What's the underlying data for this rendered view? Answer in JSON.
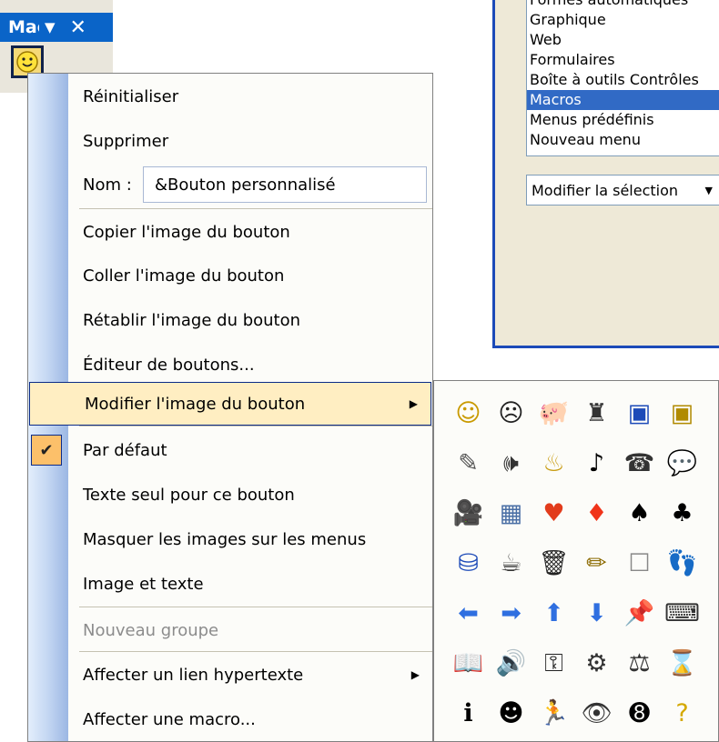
{
  "minibar": {
    "title": "Macros",
    "dropdown_glyph": "▼",
    "close_glyph": "✕",
    "button_icon": "smiley-icon"
  },
  "dialog": {
    "list_items": [
      "Formes automatiques",
      "Graphique",
      "Web",
      "Formulaires",
      "Boîte à outils Contrôles",
      "Macros",
      "Menus prédéfinis",
      "Nouveau menu"
    ],
    "selected_item": "Macros",
    "modify_selection_label": "Modifier la sélection"
  },
  "menu": {
    "reset": "Réinitialiser",
    "delete": "Supprimer",
    "name_label": "Nom :",
    "name_value": "&Bouton personnalisé",
    "copy_image": "Copier l'image du bouton",
    "paste_image": "Coller l'image du bouton",
    "restore_image": "Rétablir l'image du bouton",
    "button_editor": "Éditeur de boutons...",
    "change_image": "Modifier l'image du bouton",
    "default_style": "Par défaut",
    "text_only": "Texte seul pour ce bouton",
    "hide_images": "Masquer les images sur les menus",
    "image_and_text": "Image et texte",
    "new_group": "Nouveau groupe",
    "assign_hyperlink": "Affecter un lien hypertexte",
    "assign_macro": "Affecter une macro..."
  },
  "colors": {
    "title_bar": "#0a64c8",
    "highlight": "#ffeec2",
    "highlight_border": "#0b2b88",
    "selection": "#316ac5",
    "checked": "#fcc06a"
  },
  "picker": {
    "icons": [
      {
        "name": "smiley-icon",
        "glyph": "☺",
        "color": "#c99a00"
      },
      {
        "name": "frown-icon",
        "glyph": "☹",
        "color": "#222"
      },
      {
        "name": "piggy-bank-icon",
        "glyph": "🐖",
        "color": "#444"
      },
      {
        "name": "pen-stand-icon",
        "glyph": "♜",
        "color": "#333"
      },
      {
        "name": "save-blue-icon",
        "glyph": "▣",
        "color": "#1c4ab8"
      },
      {
        "name": "save-yellow-icon",
        "glyph": "▣",
        "color": "#b08a00"
      },
      {
        "name": "microphone-icon",
        "glyph": "✎",
        "color": "#555"
      },
      {
        "name": "speaker-icon",
        "glyph": "🕪",
        "color": "#333"
      },
      {
        "name": "bell-icon",
        "glyph": "♨",
        "color": "#c89c12"
      },
      {
        "name": "music-note-icon",
        "glyph": "♪",
        "color": "#000"
      },
      {
        "name": "telephone-icon",
        "glyph": "☎",
        "color": "#333"
      },
      {
        "name": "speech-bubble-icon",
        "glyph": "💬",
        "color": "#333"
      },
      {
        "name": "camera-icon",
        "glyph": "🎥",
        "color": "#555"
      },
      {
        "name": "calculator-icon",
        "glyph": "▦",
        "color": "#4a6fa5"
      },
      {
        "name": "heart-icon",
        "glyph": "♥",
        "color": "#e23c1c"
      },
      {
        "name": "diamond-icon",
        "glyph": "♦",
        "color": "#f0341a"
      },
      {
        "name": "spade-icon",
        "glyph": "♠",
        "color": "#000"
      },
      {
        "name": "club-icon",
        "glyph": "♣",
        "color": "#000"
      },
      {
        "name": "paint-can-icon",
        "glyph": "⛁",
        "color": "#1c4ab8"
      },
      {
        "name": "mug-icon",
        "glyph": "☕",
        "color": "#333"
      },
      {
        "name": "trash-icon",
        "glyph": "🗑",
        "color": "#222"
      },
      {
        "name": "pencil-icon",
        "glyph": "✏",
        "color": "#8b6a00"
      },
      {
        "name": "blank-square-icon",
        "glyph": "☐",
        "color": "#888"
      },
      {
        "name": "footprints-icon",
        "glyph": "👣",
        "color": "#444"
      },
      {
        "name": "arrow-left-icon",
        "glyph": "⬅",
        "color": "#2f6fe0"
      },
      {
        "name": "arrow-right-icon",
        "glyph": "➡",
        "color": "#2f6fe0"
      },
      {
        "name": "arrow-up-icon",
        "glyph": "⬆",
        "color": "#2f6fe0"
      },
      {
        "name": "arrow-down-icon",
        "glyph": "⬇",
        "color": "#2f6fe0"
      },
      {
        "name": "pushpin-icon",
        "glyph": "📌",
        "color": "#777"
      },
      {
        "name": "keyboard-icon",
        "glyph": "⌨",
        "color": "#333"
      },
      {
        "name": "book-icon",
        "glyph": "📖",
        "color": "#333"
      },
      {
        "name": "sound-wave-icon",
        "glyph": "🔊",
        "color": "#333"
      },
      {
        "name": "key-icon",
        "glyph": "⚿",
        "color": "#222"
      },
      {
        "name": "film-reel-icon",
        "glyph": "⚙",
        "color": "#333"
      },
      {
        "name": "scales-icon",
        "glyph": "⚖",
        "color": "#333"
      },
      {
        "name": "hourglass-icon",
        "glyph": "⌛",
        "color": "#333"
      },
      {
        "name": "info-person-icon",
        "glyph": "ℹ",
        "color": "#000"
      },
      {
        "name": "head-profile-icon",
        "glyph": "☻",
        "color": "#000"
      },
      {
        "name": "running-man-icon",
        "glyph": "🏃",
        "color": "#333"
      },
      {
        "name": "eye-icon",
        "glyph": "👁",
        "color": "#333"
      },
      {
        "name": "eight-ball-icon",
        "glyph": "➑",
        "color": "#000"
      },
      {
        "name": "question-mark-icon",
        "glyph": "?",
        "color": "#d4a800"
      }
    ]
  }
}
